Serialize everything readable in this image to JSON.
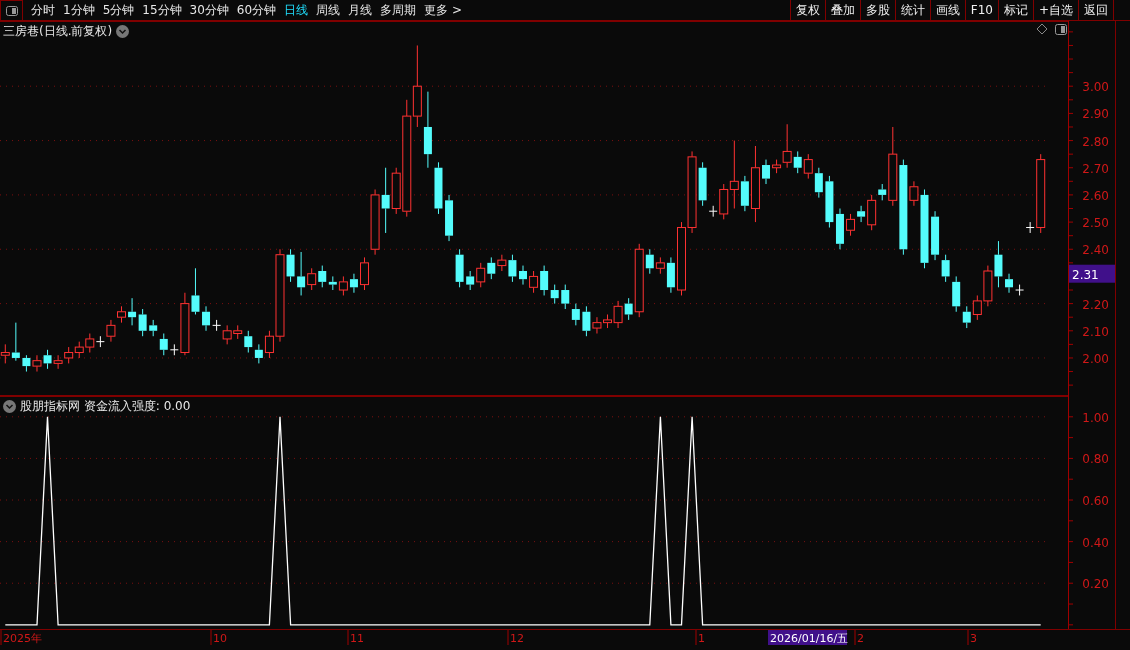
{
  "toolbar": {
    "periods": [
      {
        "label": "分时",
        "selected": false
      },
      {
        "label": "1分钟",
        "selected": false
      },
      {
        "label": "5分钟",
        "selected": false
      },
      {
        "label": "15分钟",
        "selected": false
      },
      {
        "label": "30分钟",
        "selected": false
      },
      {
        "label": "60分钟",
        "selected": false
      },
      {
        "label": "日线",
        "selected": true
      },
      {
        "label": "周线",
        "selected": false
      },
      {
        "label": "月线",
        "selected": false
      },
      {
        "label": "多周期",
        "selected": false
      },
      {
        "label": "更多 >",
        "selected": false
      }
    ],
    "actions": [
      "复权",
      "叠加",
      "多股",
      "统计",
      "画线",
      "F10",
      "标记",
      "+自选",
      "返回"
    ]
  },
  "main_chart": {
    "title": "三房巷(日线.前复权)",
    "last_price_tag": "2.31",
    "chart_data": {
      "type": "candlestick",
      "grid": true,
      "ylim": [
        1.86,
        3.24
      ],
      "yticks": [
        {
          "value": 3.0,
          "label": "3.00"
        },
        {
          "value": 2.9,
          "label": "2.90"
        },
        {
          "value": 2.8,
          "label": "2.80"
        },
        {
          "value": 2.7,
          "label": "2.70"
        },
        {
          "value": 2.6,
          "label": "2.60"
        },
        {
          "value": 2.5,
          "label": "2.50"
        },
        {
          "value": 2.4,
          "label": "2.40"
        },
        {
          "value": 2.2,
          "label": "2.20"
        },
        {
          "value": 2.1,
          "label": "2.10"
        },
        {
          "value": 2.0,
          "label": "2.00"
        }
      ],
      "categories": [
        null,
        null,
        null,
        null,
        null,
        null,
        null,
        null,
        null,
        null,
        null,
        null,
        null,
        null,
        null,
        null,
        null,
        null,
        null,
        null,
        null,
        null,
        null,
        null,
        null,
        null,
        null,
        null,
        null,
        null,
        null,
        null,
        null,
        null,
        null,
        null,
        null,
        null,
        null,
        null,
        null,
        null,
        null,
        null,
        null,
        null,
        null,
        null,
        null,
        null,
        null,
        null,
        null,
        null,
        null,
        null,
        null,
        null,
        null,
        null,
        null,
        null,
        null,
        null,
        null,
        null,
        null,
        null,
        null,
        null,
        null,
        null,
        null,
        null,
        null,
        null,
        null,
        null,
        null,
        null,
        null,
        null,
        null,
        null,
        null,
        null,
        null,
        null,
        null,
        null,
        null,
        null,
        null,
        null,
        null,
        null,
        null,
        null,
        null
      ],
      "ohlc": [
        [
          2.01,
          2.05,
          1.98,
          2.02
        ],
        [
          2.02,
          2.13,
          1.99,
          2.0
        ],
        [
          2.0,
          2.01,
          1.95,
          1.97
        ],
        [
          1.97,
          2.01,
          1.95,
          1.99
        ],
        [
          2.01,
          2.03,
          1.96,
          1.98
        ],
        [
          1.98,
          2.01,
          1.96,
          1.99
        ],
        [
          2.0,
          2.04,
          1.98,
          2.02
        ],
        [
          2.02,
          2.06,
          2.0,
          2.04
        ],
        [
          2.04,
          2.09,
          2.02,
          2.07
        ],
        [
          2.06,
          2.08,
          2.04,
          2.06
        ],
        [
          2.08,
          2.14,
          2.06,
          2.12
        ],
        [
          2.15,
          2.19,
          2.13,
          2.17
        ],
        [
          2.17,
          2.22,
          2.12,
          2.15
        ],
        [
          2.16,
          2.18,
          2.08,
          2.1
        ],
        [
          2.12,
          2.14,
          2.08,
          2.1
        ],
        [
          2.07,
          2.09,
          2.01,
          2.03
        ],
        [
          2.03,
          2.05,
          2.01,
          2.03
        ],
        [
          2.02,
          2.24,
          2.01,
          2.2
        ],
        [
          2.23,
          2.33,
          2.16,
          2.17
        ],
        [
          2.17,
          2.19,
          2.1,
          2.12
        ],
        [
          2.12,
          2.14,
          2.1,
          2.12
        ],
        [
          2.07,
          2.12,
          2.05,
          2.1
        ],
        [
          2.09,
          2.12,
          2.07,
          2.1
        ],
        [
          2.08,
          2.1,
          2.02,
          2.04
        ],
        [
          2.03,
          2.05,
          1.98,
          2.0
        ],
        [
          2.02,
          2.1,
          2.0,
          2.08
        ],
        [
          2.08,
          2.4,
          2.06,
          2.38
        ],
        [
          2.38,
          2.4,
          2.28,
          2.3
        ],
        [
          2.3,
          2.39,
          2.23,
          2.26
        ],
        [
          2.27,
          2.33,
          2.25,
          2.31
        ],
        [
          2.32,
          2.34,
          2.26,
          2.28
        ],
        [
          2.28,
          2.3,
          2.25,
          2.27
        ],
        [
          2.25,
          2.3,
          2.23,
          2.28
        ],
        [
          2.29,
          2.31,
          2.24,
          2.26
        ],
        [
          2.27,
          2.37,
          2.25,
          2.35
        ],
        [
          2.4,
          2.62,
          2.38,
          2.6
        ],
        [
          2.6,
          2.7,
          2.46,
          2.55
        ],
        [
          2.55,
          2.7,
          2.53,
          2.68
        ],
        [
          2.54,
          2.95,
          2.52,
          2.89
        ],
        [
          2.89,
          3.15,
          2.85,
          3.0
        ],
        [
          2.85,
          2.98,
          2.7,
          2.75
        ],
        [
          2.7,
          2.72,
          2.53,
          2.55
        ],
        [
          2.58,
          2.6,
          2.43,
          2.45
        ],
        [
          2.38,
          2.4,
          2.26,
          2.28
        ],
        [
          2.3,
          2.32,
          2.25,
          2.27
        ],
        [
          2.28,
          2.35,
          2.26,
          2.33
        ],
        [
          2.35,
          2.37,
          2.29,
          2.31
        ],
        [
          2.34,
          2.38,
          2.32,
          2.36
        ],
        [
          2.36,
          2.38,
          2.28,
          2.3
        ],
        [
          2.32,
          2.34,
          2.27,
          2.29
        ],
        [
          2.26,
          2.32,
          2.24,
          2.3
        ],
        [
          2.32,
          2.34,
          2.23,
          2.25
        ],
        [
          2.25,
          2.27,
          2.2,
          2.22
        ],
        [
          2.25,
          2.27,
          2.18,
          2.2
        ],
        [
          2.18,
          2.2,
          2.12,
          2.14
        ],
        [
          2.17,
          2.19,
          2.08,
          2.1
        ],
        [
          2.11,
          2.15,
          2.09,
          2.13
        ],
        [
          2.13,
          2.16,
          2.11,
          2.14
        ],
        [
          2.13,
          2.21,
          2.11,
          2.19
        ],
        [
          2.2,
          2.22,
          2.14,
          2.16
        ],
        [
          2.17,
          2.42,
          2.15,
          2.4
        ],
        [
          2.38,
          2.4,
          2.31,
          2.33
        ],
        [
          2.33,
          2.37,
          2.31,
          2.35
        ],
        [
          2.35,
          2.37,
          2.24,
          2.26
        ],
        [
          2.25,
          2.5,
          2.23,
          2.48
        ],
        [
          2.48,
          2.76,
          2.46,
          2.74
        ],
        [
          2.7,
          2.72,
          2.56,
          2.58
        ],
        [
          2.54,
          2.56,
          2.52,
          2.54
        ],
        [
          2.53,
          2.64,
          2.51,
          2.62
        ],
        [
          2.62,
          2.8,
          2.55,
          2.65
        ],
        [
          2.65,
          2.67,
          2.54,
          2.56
        ],
        [
          2.55,
          2.78,
          2.5,
          2.7
        ],
        [
          2.71,
          2.73,
          2.64,
          2.66
        ],
        [
          2.7,
          2.73,
          2.68,
          2.71
        ],
        [
          2.72,
          2.86,
          2.7,
          2.76
        ],
        [
          2.74,
          2.76,
          2.68,
          2.7
        ],
        [
          2.68,
          2.75,
          2.66,
          2.73
        ],
        [
          2.68,
          2.7,
          2.59,
          2.61
        ],
        [
          2.65,
          2.67,
          2.48,
          2.5
        ],
        [
          2.53,
          2.55,
          2.4,
          2.42
        ],
        [
          2.47,
          2.53,
          2.45,
          2.51
        ],
        [
          2.54,
          2.56,
          2.5,
          2.52
        ],
        [
          2.49,
          2.6,
          2.47,
          2.58
        ],
        [
          2.62,
          2.64,
          2.58,
          2.6
        ],
        [
          2.58,
          2.85,
          2.56,
          2.75
        ],
        [
          2.71,
          2.73,
          2.38,
          2.4
        ],
        [
          2.58,
          2.65,
          2.56,
          2.63
        ],
        [
          2.6,
          2.62,
          2.33,
          2.35
        ],
        [
          2.52,
          2.54,
          2.36,
          2.38
        ],
        [
          2.36,
          2.38,
          2.28,
          2.3
        ],
        [
          2.28,
          2.3,
          2.17,
          2.19
        ],
        [
          2.17,
          2.19,
          2.11,
          2.13
        ],
        [
          2.16,
          2.23,
          2.14,
          2.21
        ],
        [
          2.21,
          2.34,
          2.19,
          2.32
        ],
        [
          2.38,
          2.43,
          2.26,
          2.3
        ],
        [
          2.29,
          2.31,
          2.24,
          2.26
        ],
        [
          2.25,
          2.27,
          2.23,
          2.25
        ],
        [
          2.48,
          2.5,
          2.46,
          2.48
        ],
        [
          2.48,
          2.75,
          2.46,
          2.73
        ]
      ]
    }
  },
  "indicator": {
    "title": "股朋指标网 资金流入强度: 0.00",
    "chart_data": {
      "type": "line",
      "grid": true,
      "ylim": [
        -0.02,
        1.1
      ],
      "yticks": [
        {
          "value": 0.2,
          "label": "0.20"
        },
        {
          "value": 0.4,
          "label": "0.40"
        },
        {
          "value": 0.6,
          "label": "0.60"
        },
        {
          "value": 0.8,
          "label": "0.80"
        },
        {
          "value": 1.0,
          "label": "1.00"
        }
      ],
      "categories": [
        null,
        null,
        null,
        null,
        null,
        null,
        null,
        null,
        null,
        null,
        null,
        null,
        null,
        null,
        null,
        null,
        null,
        null,
        null,
        null,
        null,
        null,
        null,
        null,
        null,
        null,
        null,
        null,
        null,
        null,
        null,
        null,
        null,
        null,
        null,
        null,
        null,
        null,
        null,
        null,
        null,
        null,
        null,
        null,
        null,
        null,
        null,
        null,
        null,
        null,
        null,
        null,
        null,
        null,
        null,
        null,
        null,
        null,
        null,
        null,
        null,
        null,
        null,
        null,
        null,
        null,
        null,
        null,
        null,
        null,
        null,
        null,
        null,
        null,
        null,
        null,
        null,
        null,
        null,
        null,
        null,
        null,
        null,
        null,
        null,
        null,
        null,
        null,
        null,
        null,
        null,
        null,
        null,
        null,
        null,
        null,
        null,
        null,
        null
      ],
      "series": [
        {
          "color": "#ffffff",
          "values": [
            0,
            0,
            0,
            0,
            1,
            0,
            0,
            0,
            0,
            0,
            0,
            0,
            0,
            0,
            0,
            0,
            0,
            0,
            0,
            0,
            0,
            0,
            0,
            0,
            0,
            0,
            1,
            0,
            0,
            0,
            0,
            0,
            0,
            0,
            0,
            0,
            0,
            0,
            0,
            0,
            0,
            0,
            0,
            0,
            0,
            0,
            0,
            0,
            0,
            0,
            0,
            0,
            0,
            0,
            0,
            0,
            0,
            0,
            0,
            0,
            0,
            0,
            1,
            0,
            0,
            1,
            0,
            0,
            0,
            0,
            0,
            0,
            0,
            0,
            0,
            0,
            0,
            0,
            0,
            0,
            0,
            0,
            0,
            0,
            0,
            0,
            0,
            0,
            0,
            0,
            0,
            0,
            0,
            0,
            0,
            0,
            0,
            0,
            0
          ]
        }
      ]
    }
  },
  "time_axis": [
    {
      "label": "2025年",
      "selected": false
    },
    {
      "label": "10",
      "selected": false
    },
    {
      "label": "11",
      "selected": false
    },
    {
      "label": "12",
      "selected": false
    },
    {
      "label": "1",
      "selected": false
    },
    {
      "label": "2026/01/16/五",
      "selected": true
    },
    {
      "label": "2",
      "selected": false
    },
    {
      "label": "3",
      "selected": false
    }
  ]
}
